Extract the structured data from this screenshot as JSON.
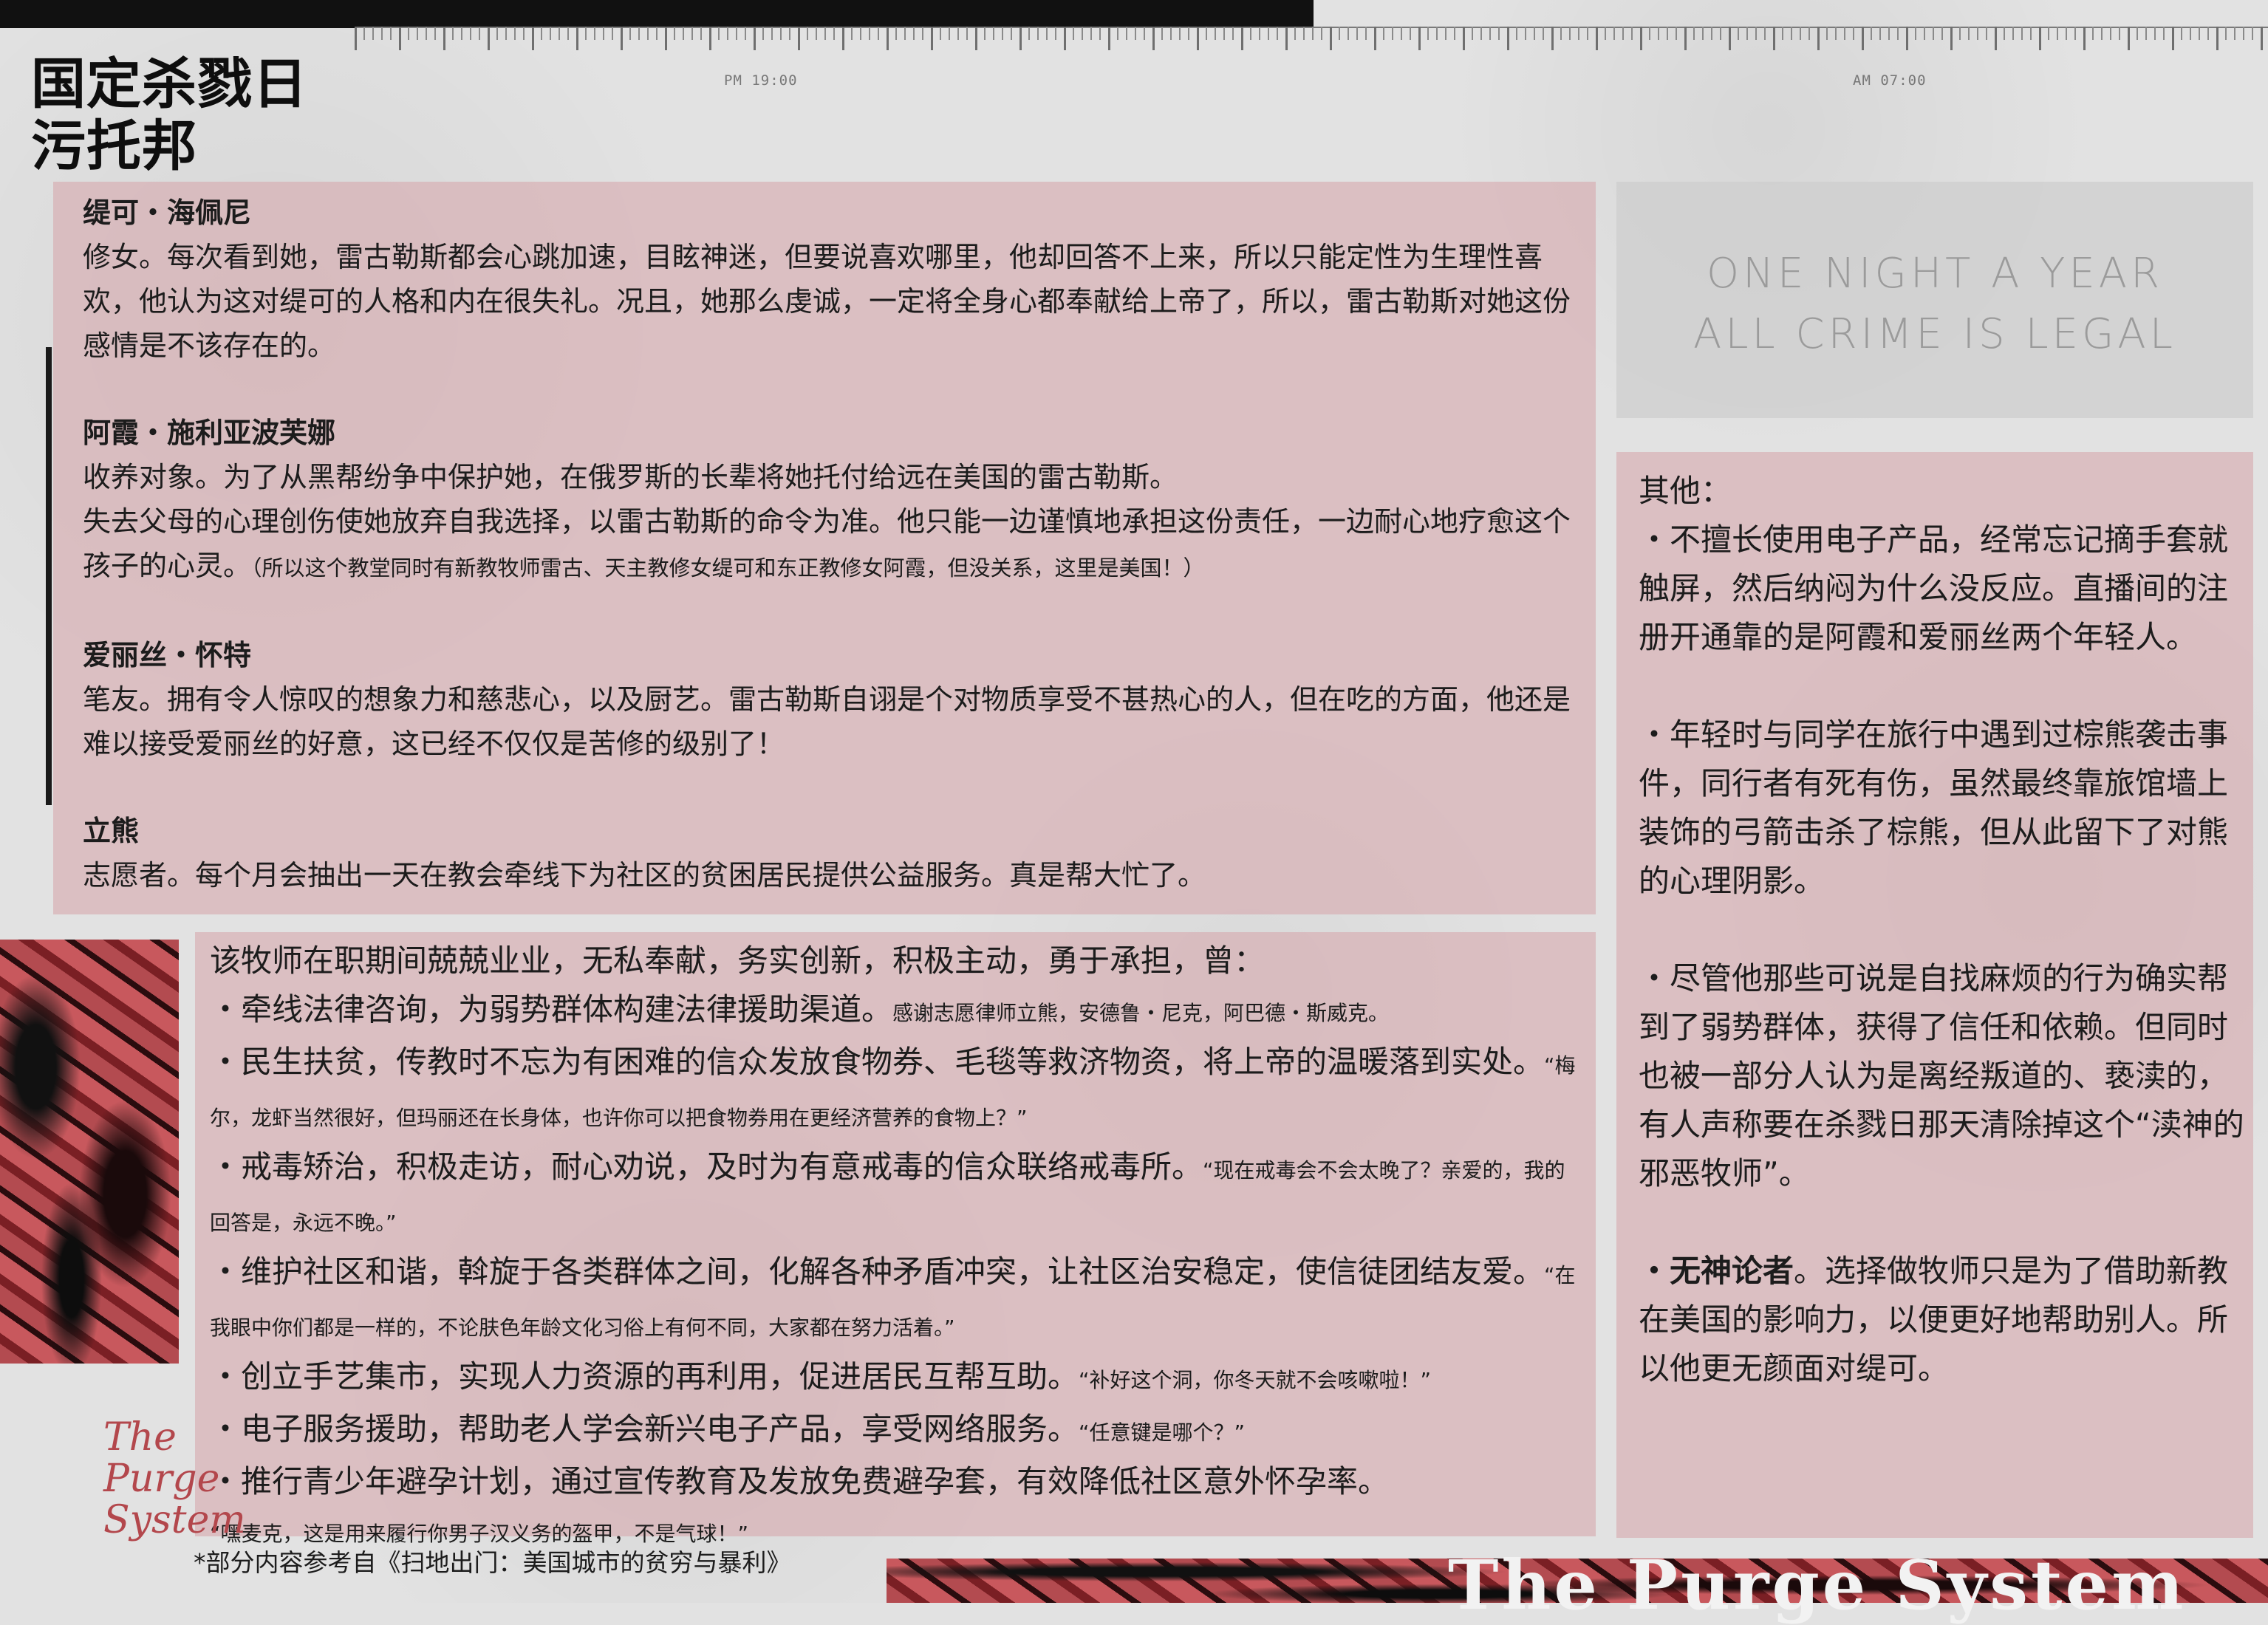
{
  "title": {
    "line1": "国定杀戮日",
    "line2": "污托邦"
  },
  "timeline": {
    "left": "PM 19:00",
    "right": "AM 07:00"
  },
  "slogan": {
    "line1": "ONE NIGHT A YEAR",
    "line2": "ALL CRIME IS LEGAL"
  },
  "characters": [
    {
      "name": "缇可・海佩尼",
      "text": "修女。每次看到她，雷古勒斯都会心跳加速，目眩神迷，但要说喜欢哪里，他却回答不上来，所以只能定性为生理性喜欢，他认为这对缇可的人格和内在很失礼。况且，她那么虔诚，一定将全身心都奉献给上帝了，所以，雷古勒斯对她这份感情是不该存在的。",
      "note": ""
    },
    {
      "name": "阿霞・施利亚波芙娜",
      "text": "收养对象。为了从黑帮纷争中保护她，在俄罗斯的长辈将她托付给远在美国的雷古勒斯。\n失去父母的心理创伤使她放弃自我选择，以雷古勒斯的命令为准。他只能一边谨慎地承担这份责任，一边耐心地疗愈这个孩子的心灵。",
      "note": "（所以这个教堂同时有新教牧师雷古、天主教修女缇可和东正教修女阿霞，但没关系，这里是美国！）"
    },
    {
      "name": "爱丽丝・怀特",
      "text": "笔友。拥有令人惊叹的想象力和慈悲心，以及厨艺。雷古勒斯自诩是个对物质享受不甚热心的人，但在吃的方面，他还是难以接受爱丽丝的好意，这已经不仅仅是苦修的级别了！",
      "note": ""
    },
    {
      "name": "立熊",
      "text": "志愿者。每个月会抽出一天在教会牵线下为社区的贫困居民提供公益服务。真是帮大忙了。",
      "note": ""
    }
  ],
  "deeds": {
    "lead": "该牧师在职期间兢兢业业，无私奉献，务实创新，积极主动，勇于承担，曾：",
    "items": [
      {
        "text": "・牵线法律咨询，为弱势群体构建法律援助渠道。",
        "quote": "感谢志愿律师立熊，安德鲁・尼克，阿巴德・斯威克。"
      },
      {
        "text": "・民生扶贫，传教时不忘为有困难的信众发放食物券、毛毯等救济物资，将上帝的温暖落到实处。",
        "quote": "“梅尔，龙虾当然很好，但玛丽还在长身体，也许你可以把食物券用在更经济营养的食物上？”"
      },
      {
        "text": "・戒毒矫治，积极走访，耐心劝说，及时为有意戒毒的信众联络戒毒所。",
        "quote": "“现在戒毒会不会太晚了？亲爱的，我的回答是，永远不晚。”"
      },
      {
        "text": "・维护社区和谐，斡旋于各类群体之间，化解各种矛盾冲突，让社区治安稳定，使信徒团结友爱。",
        "quote": "“在我眼中你们都是一样的，不论肤色年龄文化习俗上有何不同，大家都在努力活着。”"
      },
      {
        "text": "・创立手艺集市，实现人力资源的再利用，促进居民互帮互助。",
        "quote": "“补好这个洞，你冬天就不会咳嗽啦！”"
      },
      {
        "text": "・电子服务援助，帮助老人学会新兴电子产品，享受网络服务。",
        "quote": "“任意键是哪个？”"
      },
      {
        "text": "・推行青少年避孕计划，通过宣传教育及发放免费避孕套，有效降低社区意外怀孕率。",
        "quote": ""
      }
    ],
    "tail_quote": "“嘿麦克，这是用来履行你男子汉义务的盔甲，不是气球！”"
  },
  "other": {
    "head": "其他：",
    "paras": [
      "・不擅长使用电子产品，经常忘记摘手套就触屏，然后纳闷为什么没反应。直播间的注册开通靠的是阿霞和爱丽丝两个年轻人。",
      "・年轻时与同学在旅行中遇到过棕熊袭击事件，同行者有死有伤，虽然最终靠旅馆墙上装饰的弓箭击杀了棕熊，但从此留下了对熊的心理阴影。",
      "・尽管他那些可说是自找麻烦的行为确实帮到了弱势群体，获得了信任和依赖。但同时也被一部分人认为是离经叛道的、亵渎的，有人声称要在杀戮日那天清除掉这个“渎神的邪恶牧师”。"
    ],
    "last_bold": "・无神论者",
    "last_rest": "。选择做牧师只是为了借助新教在美国的影响力，以便更好地帮助别人。所以他更无颜面对缇可。"
  },
  "signature": "The Purge System",
  "bottom_gothic": "The Purge System",
  "footnote": "*部分内容参考自《扫地出门：美国城市的贫穷与暴利》",
  "colors": {
    "panel_pink": "#d6aaae",
    "accent_red": "#b3474c",
    "ink": "#1c1c1c"
  }
}
